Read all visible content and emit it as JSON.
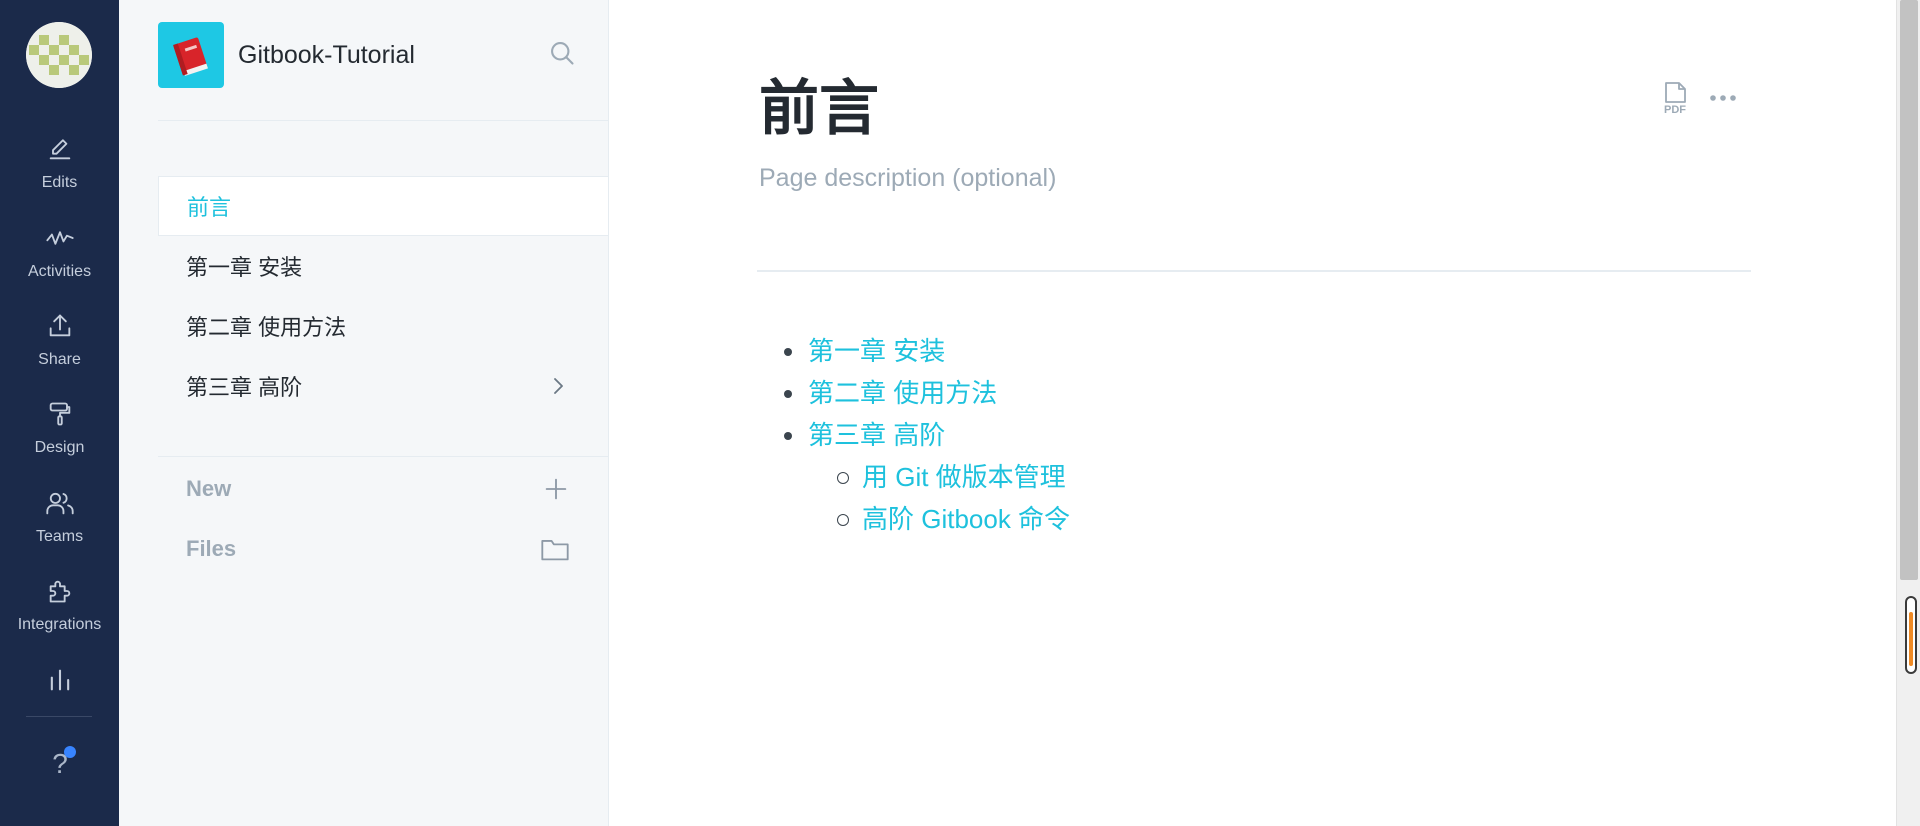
{
  "rail": {
    "items": [
      {
        "label": "Edits",
        "icon": "pencil-icon"
      },
      {
        "label": "Activities",
        "icon": "activity-icon"
      },
      {
        "label": "Share",
        "icon": "share-icon"
      },
      {
        "label": "Design",
        "icon": "paint-roller-icon"
      },
      {
        "label": "Teams",
        "icon": "users-icon"
      },
      {
        "label": "Integrations",
        "icon": "puzzle-icon"
      }
    ],
    "analytics_icon": "bar-chart-icon",
    "help_label": "?"
  },
  "sidebar": {
    "space_title": "Gitbook-Tutorial",
    "nav": [
      {
        "label": "前言"
      },
      {
        "label": "第一章 安装"
      },
      {
        "label": "第二章 使用方法"
      },
      {
        "label": "第三章 高阶"
      }
    ],
    "tools": [
      {
        "label": "New",
        "icon": "plus-icon"
      },
      {
        "label": "Files",
        "icon": "folder-icon"
      }
    ]
  },
  "main": {
    "title": "前言",
    "description_placeholder": "Page description (optional)",
    "toc": [
      {
        "label": "第一章 安装",
        "level": 1
      },
      {
        "label": "第二章 使用方法",
        "level": 1
      },
      {
        "label": "第三章 高阶",
        "level": 1
      },
      {
        "label": "用 Git 做版本管理",
        "level": 2
      },
      {
        "label": "高阶 Gitbook 命令",
        "level": 2
      }
    ],
    "pdf_label": "PDF"
  },
  "colors": {
    "accent": "#1ec1dd",
    "rail_bg": "#1b2a4a",
    "sidebar_bg": "#f5f7f9",
    "text": "#242a31",
    "muted": "#9daab6"
  }
}
